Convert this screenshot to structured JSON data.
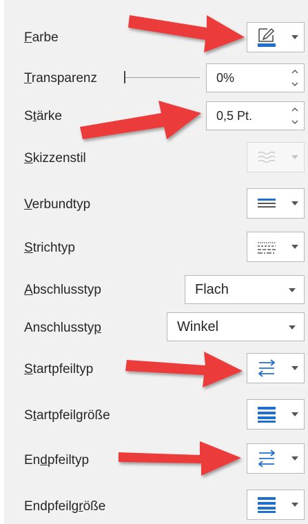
{
  "rows": {
    "farbe": {
      "label_u": "F",
      "label_rest": "arbe"
    },
    "transparenz": {
      "label_u": "T",
      "label_rest": "ransparenz",
      "value": "0%"
    },
    "staerke": {
      "label_pre": "S",
      "label_u": "t",
      "label_rest": "ärke",
      "value": "0,5 Pt."
    },
    "skizzenstil": {
      "label_u": "S",
      "label_rest": "kizzenstil"
    },
    "verbundtyp": {
      "label_u": "V",
      "label_rest": "erbundtyp"
    },
    "strichtyp": {
      "label_u": "S",
      "label_rest": "trichtyp"
    },
    "abschlusstyp": {
      "label_u": "A",
      "label_rest": "bschlusstyp",
      "value": "Flach"
    },
    "anschlusstyp": {
      "label_pre": "Anschlussty",
      "label_u": "p",
      "label_rest": "",
      "value": "Winkel"
    },
    "startpfeiltyp": {
      "label_u": "S",
      "label_rest": "tartpfeiltyp"
    },
    "startpfeilgroesse": {
      "label_pre": "S",
      "label_u": "t",
      "label_rest": "artpfeilgröße"
    },
    "endpfeiltyp": {
      "label_pre": "En",
      "label_u": "d",
      "label_rest": "pfeiltyp"
    },
    "endpfeilgroesse": {
      "label_pre": "Endpfeilg",
      "label_u": "r",
      "label_rest": "öße"
    }
  },
  "colors": {
    "accent_blue": "#1f6fd1",
    "annotation_red": "#ec3a3a"
  },
  "icons": {
    "farbe": "pen-color-icon",
    "skizzenstil": "sketch-style-icon",
    "verbundtyp": "compound-type-icon",
    "strichtyp": "dash-type-icon",
    "startpfeiltyp": "arrow-type-icon",
    "startpfeilgroesse": "arrow-size-icon",
    "endpfeiltyp": "arrow-type-icon",
    "endpfeilgroesse": "arrow-size-icon"
  }
}
